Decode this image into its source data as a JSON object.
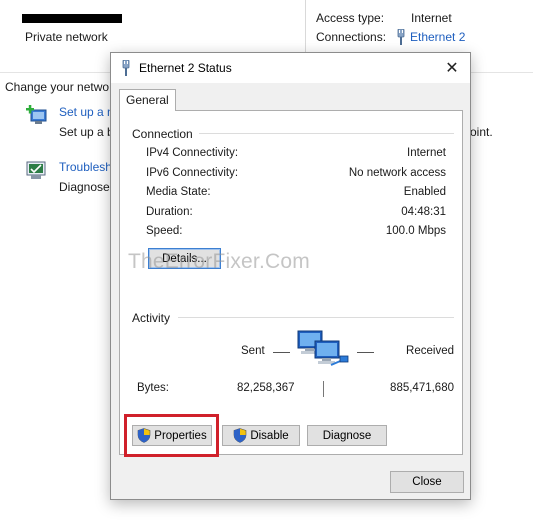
{
  "background": {
    "network_type": "Private network",
    "access_type_label": "Access type:",
    "access_type_value": "Internet",
    "connections_label": "Connections:",
    "connections_value": "Ethernet 2",
    "change_heading": "Change your netwo",
    "setup_link": "Set up a n",
    "setup_desc": "Set up a b",
    "trouble_link": "Troublesh",
    "trouble_desc": "Diagnose",
    "point_fragment": "oint."
  },
  "dialog": {
    "title": "Ethernet 2 Status",
    "tab_general": "General",
    "connection_group": "Connection",
    "rows": [
      {
        "label": "IPv4 Connectivity:",
        "value": "Internet"
      },
      {
        "label": "IPv6 Connectivity:",
        "value": "No network access"
      },
      {
        "label": "Media State:",
        "value": "Enabled"
      },
      {
        "label": "Duration:",
        "value": "04:48:31"
      },
      {
        "label": "Speed:",
        "value": "100.0 Mbps"
      }
    ],
    "details_button": "Details...",
    "activity_group": "Activity",
    "sent_label": "Sent",
    "received_label": "Received",
    "bytes_label": "Bytes:",
    "bytes_sent": "82,258,367",
    "bytes_received": "885,471,680",
    "properties_button": "Properties",
    "disable_button": "Disable",
    "diagnose_button": "Diagnose",
    "close_button": "Close"
  },
  "watermark": "TheErrorFixer.Com",
  "colors": {
    "link": "#1f5fbf",
    "highlight": "#d0202a",
    "dialog_bg": "#f0f0f0",
    "button_bg": "#e1e1e1",
    "focus_border": "#3c7fd1"
  },
  "icons": {
    "title": "network-cable-icon",
    "connection": "network-cable-icon",
    "setup": "new-connection-icon",
    "trouble": "troubleshoot-icon",
    "activity": "network-computers-icon",
    "uac": "uac-shield-icon"
  }
}
